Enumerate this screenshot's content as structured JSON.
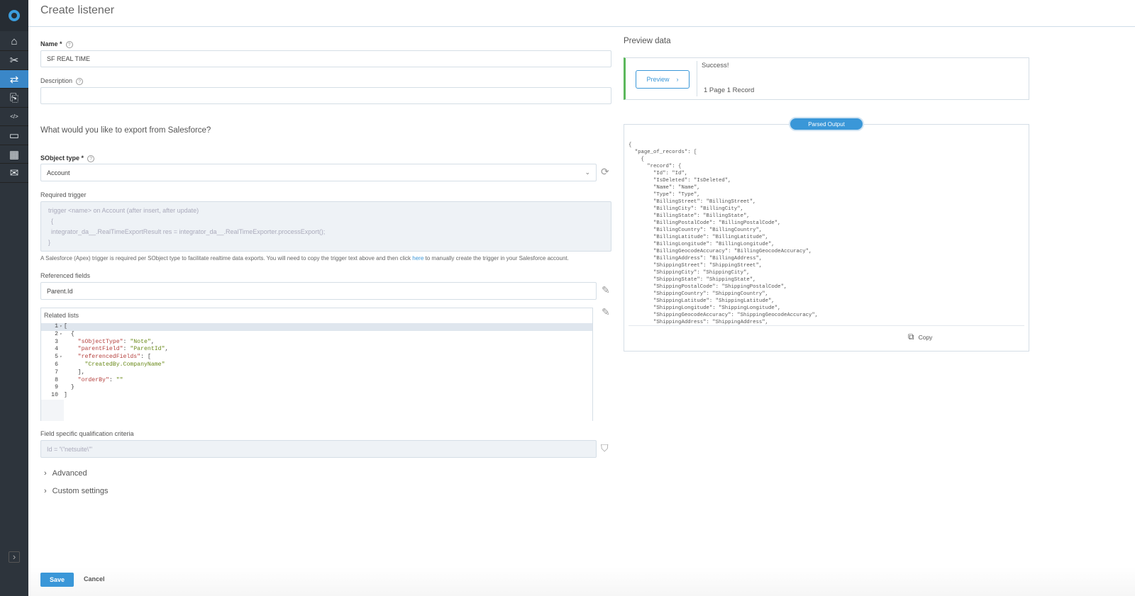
{
  "app": {
    "title": "Create listener"
  },
  "sidebar": {
    "items": [
      {
        "name": "home",
        "icon": "⌂"
      },
      {
        "name": "tools",
        "icon": "✂"
      },
      {
        "name": "flows",
        "icon": "⇄",
        "active": true
      },
      {
        "name": "exports",
        "icon": "⎘"
      },
      {
        "name": "scripts",
        "icon": "</>"
      },
      {
        "name": "resources",
        "icon": "▭"
      },
      {
        "name": "marketplace",
        "icon": "▦"
      },
      {
        "name": "support",
        "icon": "✉"
      }
    ],
    "expand_icon": "›"
  },
  "form": {
    "name_label": "Name *",
    "name_value": "SF REAL TIME",
    "description_label": "Description",
    "description_value": "",
    "export_question": "What would you like to export from Salesforce?",
    "sobject_label": "SObject type *",
    "sobject_value": "Account",
    "trigger_label": "Required trigger",
    "trigger_lines": [
      "trigger <name> on Account (after insert, after update)",
      "{",
      "integrator_da__.RealTimeExportResult res = integrator_da__.RealTimeExporter.processExport();",
      "}"
    ],
    "trigger_help_before": "A Salesforce (Apex) trigger is required per SObject type to facilitate realtime data exports. You will need to copy the trigger text above and then click ",
    "trigger_help_link": "here",
    "trigger_help_after": " to manually create the trigger in your Salesforce account.",
    "referenced_label": "Referenced fields",
    "referenced_value": "Parent.Id",
    "related_label": "Related lists",
    "related_code": [
      {
        "n": "1",
        "fold": true,
        "html": "["
      },
      {
        "n": "2",
        "fold": true,
        "html": "  {"
      },
      {
        "n": "3",
        "k": "\"sObjectType\"",
        "v": "\"Note\"",
        "tail": ","
      },
      {
        "n": "4",
        "k": "\"parentField\"",
        "v": "\"ParentId\"",
        "tail": ","
      },
      {
        "n": "5",
        "fold": true,
        "k": "\"referencedFields\"",
        "v": "[",
        "tail": ""
      },
      {
        "n": "6",
        "s": "\"CreatedBy.CompanyName\""
      },
      {
        "n": "7",
        "html": "    ],"
      },
      {
        "n": "8",
        "k": "\"orderBy\"",
        "v": "\"\"",
        "tail": ""
      },
      {
        "n": "9",
        "html": "  }"
      },
      {
        "n": "10",
        "html": "]"
      }
    ],
    "criteria_label": "Field specific qualification criteria",
    "criteria_placeholder": "Id = '\\\"netsuite\\\"'",
    "advanced_label": "Advanced",
    "custom_label": "Custom settings"
  },
  "preview": {
    "title": "Preview data",
    "button": "Preview",
    "status": "Success!",
    "summary": "1 Page 1 Record",
    "tab": "Parsed Output",
    "copy": "Copy",
    "json": "{\n  \"page_of_records\": [\n    {\n      \"record\": {\n        \"Id\": \"Id\",\n        \"IsDeleted\": \"IsDeleted\",\n        \"Name\": \"Name\",\n        \"Type\": \"Type\",\n        \"BillingStreet\": \"BillingStreet\",\n        \"BillingCity\": \"BillingCity\",\n        \"BillingState\": \"BillingState\",\n        \"BillingPostalCode\": \"BillingPostalCode\",\n        \"BillingCountry\": \"BillingCountry\",\n        \"BillingLatitude\": \"BillingLatitude\",\n        \"BillingLongitude\": \"BillingLongitude\",\n        \"BillingGeocodeAccuracy\": \"BillingGeocodeAccuracy\",\n        \"BillingAddress\": \"BillingAddress\",\n        \"ShippingStreet\": \"ShippingStreet\",\n        \"ShippingCity\": \"ShippingCity\",\n        \"ShippingState\": \"ShippingState\",\n        \"ShippingPostalCode\": \"ShippingPostalCode\",\n        \"ShippingCountry\": \"ShippingCountry\",\n        \"ShippingLatitude\": \"ShippingLatitude\",\n        \"ShippingLongitude\": \"ShippingLongitude\",\n        \"ShippingGeocodeAccuracy\": \"ShippingGeocodeAccuracy\",\n        \"ShippingAddress\": \"ShippingAddress\","
  },
  "footer": {
    "save": "Save",
    "cancel": "Cancel"
  },
  "colors": {
    "accent": "#3a97d8",
    "sidebar": "#2d343c",
    "success": "#5cb85c"
  }
}
